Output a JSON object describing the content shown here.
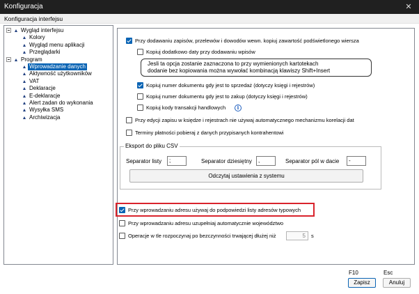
{
  "window": {
    "title": "Konfiguracja",
    "close_glyph": "✕",
    "close_icon": "close-icon"
  },
  "header": {
    "title": "Konfiguracja interfejsu"
  },
  "tree": {
    "items": [
      {
        "label": "Wygląd interfejsu",
        "level": 0,
        "expandable": true,
        "selected": false
      },
      {
        "label": "Kolory",
        "level": 1,
        "expandable": false,
        "selected": false
      },
      {
        "label": "Wygląd menu aplikacji",
        "level": 1,
        "expandable": false,
        "selected": false
      },
      {
        "label": "Przeglądarki",
        "level": 1,
        "expandable": false,
        "selected": false
      },
      {
        "label": "Program",
        "level": 0,
        "expandable": true,
        "selected": false
      },
      {
        "label": "Wprowadzanie danych",
        "level": 1,
        "expandable": false,
        "selected": true
      },
      {
        "label": "Aktywność użytkowników",
        "level": 1,
        "expandable": false,
        "selected": false
      },
      {
        "label": "VAT",
        "level": 1,
        "expandable": false,
        "selected": false
      },
      {
        "label": "Deklaracje",
        "level": 1,
        "expandable": false,
        "selected": false
      },
      {
        "label": "E-deklaracje",
        "level": 1,
        "expandable": false,
        "selected": false
      },
      {
        "label": "Alert zadan do wykonania",
        "level": 1,
        "expandable": false,
        "selected": false
      },
      {
        "label": "Wysyłka SMS",
        "level": 1,
        "expandable": false,
        "selected": false
      },
      {
        "label": "Archiwizacja",
        "level": 1,
        "expandable": false,
        "selected": false
      }
    ]
  },
  "options": {
    "copy_content": {
      "label": "Przy dodawaniu zapisów, przelewów i dowodów wewn. kopiuj zawartość podświetlonego wiersza",
      "checked": true
    },
    "copy_date": {
      "label": "Kopiuj dodatkowo daty przy dodawaniu wpisów",
      "checked": false
    },
    "info_line1": "Jesli ta opcja zostanie zaznaczona to przy wymienionych kartotekach",
    "info_line2": "dodanie bez kopiowania można wywołać kombinacją klawiszy Shift+Insert",
    "copy_doc_sale": {
      "label": "Kopiuj numer dokumentu gdy jest to sprzedaż (dotyczy księgi i rejestrów)",
      "checked": true
    },
    "copy_doc_purchase": {
      "label": "Kopiuj numer dokumentu gdy jest to zakup (dotyczy księgi i rejestrów)",
      "checked": false
    },
    "copy_codes": {
      "label": "Kopiuj kody transakcji handlowych",
      "checked": false
    },
    "info_icon_glyph": "i",
    "no_auto_correlation": {
      "label": "Przy edycji zapisu w księdze i rejestrach nie używaj automatycznego mechanizmu korelacji dat",
      "checked": false
    },
    "payment_terms": {
      "label": "Terminy płatności pobieraj z danych przypisanych kontrahentowi",
      "checked": false
    },
    "address_hints": {
      "label": "Przy wprowadzaniu adresu używaj do podpowiedzi listy adresów typowych",
      "checked": true
    },
    "address_voivodeship": {
      "label": "Przy wprowadzaniu adresu uzupełniaj automatycznie województwo",
      "checked": false
    },
    "background_ops": {
      "label": "Operacje w tle rozpoczynaj po bezczynności trwającej dłużej niż",
      "checked": false
    },
    "background_value": "5",
    "background_unit": "s"
  },
  "export": {
    "legend": "Eksport do pliku CSV",
    "list_sep_label": "Separator listy",
    "list_sep_value": ";",
    "decimal_sep_label": "Separator dziesiętny",
    "decimal_sep_value": ",",
    "date_sep_label": "Separator pól w dacie",
    "date_sep_value": "-",
    "reread_button": "Odczytaj ustawienia z systemu"
  },
  "footer": {
    "save_key": "F10",
    "save_label": "Zapisz",
    "cancel_key": "Esc",
    "cancel_label": "Anuluj"
  },
  "colors": {
    "accent": "#0a64b4",
    "highlight": "#d9232c",
    "titlebar": "#202020"
  }
}
